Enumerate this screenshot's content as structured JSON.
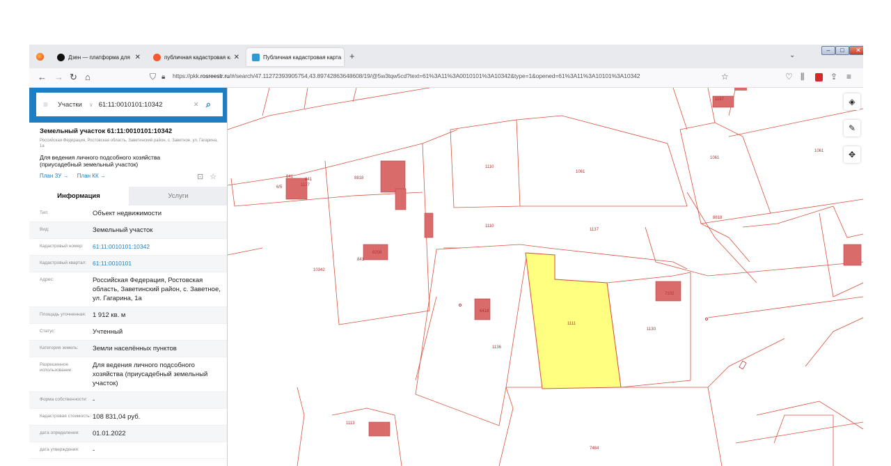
{
  "browser": {
    "tabs": [
      {
        "title": "Дзен — платформа для прос...",
        "active": false
      },
      {
        "title": "публичная кадастровая карта",
        "active": false
      },
      {
        "title": "Публичная кадастровая карта",
        "active": true
      }
    ],
    "new_tab": "+",
    "url_prefix": "https://pkk.",
    "url_host": "rosreestr.ru",
    "url_rest": "/#/search/47.11272393905754,43.89742863648608/19/@5w3tqw5cd?text=61%3A11%3A0010101%3A10342&type=1&opened=61%3A11%3A10101%3A10342"
  },
  "search": {
    "category": "Участки",
    "query": "61:11:0010101:10342"
  },
  "object": {
    "title": "Земельный участок 61:11:0010101:10342",
    "address_short": "Российская Федерация, Ростовская область, Заветинский район, с. Заветное, ул. Гагарина, 1а",
    "use": "Для ведения личного подсобного хозяйства (приусадебный земельный участок)",
    "plan_zu": "План ЗУ →",
    "plan_kk": "План КК →"
  },
  "info_tabs": {
    "info": "Информация",
    "services": "Услуги"
  },
  "properties": [
    {
      "key": "Тип:",
      "value": "Объект недвижимости",
      "link": false
    },
    {
      "key": "Вид:",
      "value": "Земельный участок",
      "link": false
    },
    {
      "key": "Кадастровый номер:",
      "value": "61:11:0010101:10342",
      "link": true
    },
    {
      "key": "Кадастровый квартал:",
      "value": "61:11:0010101",
      "link": true
    },
    {
      "key": "Адрес:",
      "value": "Российская Федерация, Ростовская область, Заветинский район, с. Заветное, ул. Гагарина, 1а",
      "link": false
    },
    {
      "key": "Площадь уточненная:",
      "value": "1 912 кв. м",
      "link": false
    },
    {
      "key": "Статус:",
      "value": "Учтенный",
      "link": false
    },
    {
      "key": "Категория земель:",
      "value": "Земли населённых пунктов",
      "link": false
    },
    {
      "key": "Разрешенное использование:",
      "value": "Для ведения личного подсобного хозяйства (приусадебный земельный участок)",
      "link": false
    },
    {
      "key": "Форма собственности:",
      "value": "-",
      "link": false
    },
    {
      "key": "Кадастровая стоимость:",
      "value": "108 831,04 руб.",
      "link": false
    },
    {
      "key": "дата определения:",
      "value": "01.01.2022",
      "link": false
    },
    {
      "key": "дата утверждения:",
      "value": "-",
      "link": false
    }
  ],
  "map_labels": [
    "841",
    "1137",
    "8818",
    "1110",
    "1061",
    "1061",
    "1061",
    "8818",
    "1110",
    "1137",
    "841",
    "10342",
    "1111",
    "1130",
    "1136",
    "1113",
    "7484",
    "8208",
    "7102",
    "6418",
    "1197",
    "6/5",
    "841"
  ],
  "colors": {
    "accent": "#1f7ec1",
    "selected_parcel": "#ffff80",
    "parcel_border": "#d9503c",
    "building": "#d96b6b"
  }
}
